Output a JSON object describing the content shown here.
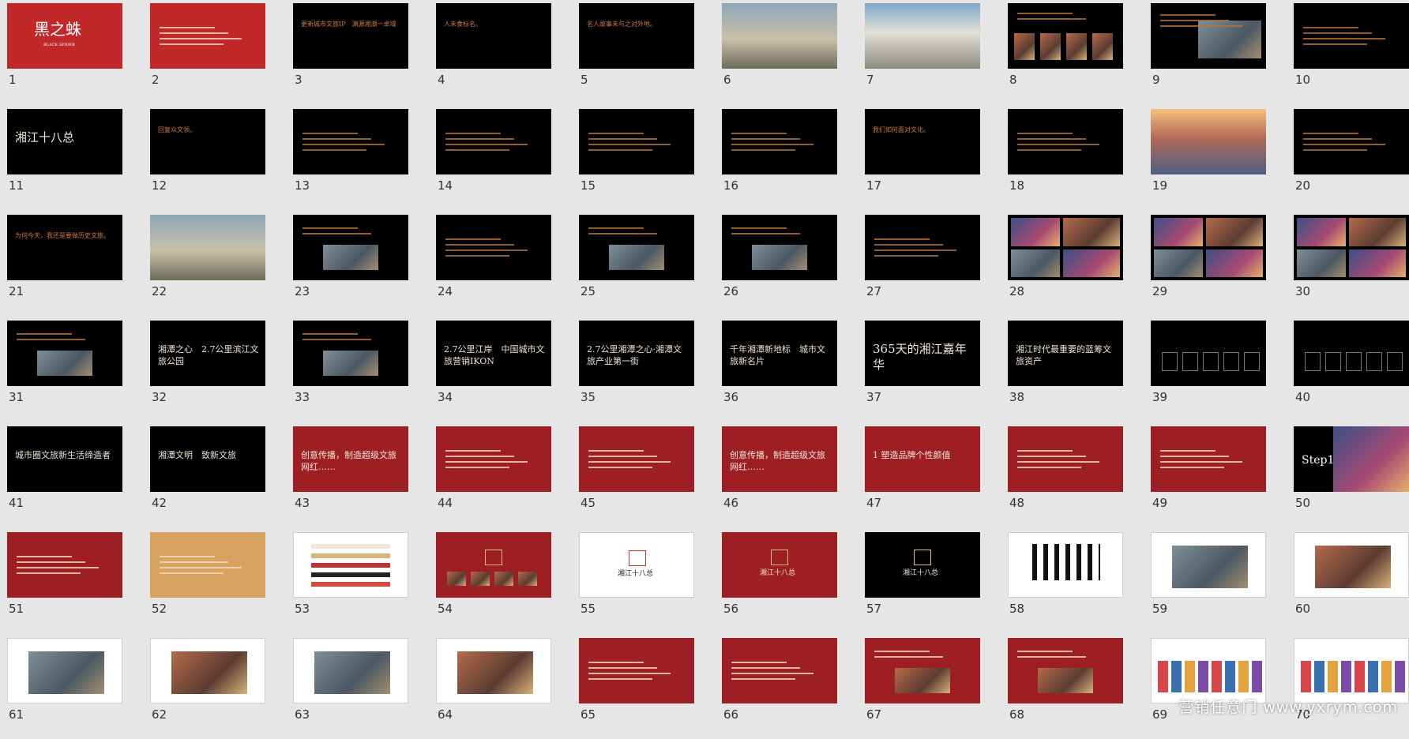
{
  "watermark": "营销任意门 www.yxrym.com",
  "slides": [
    {
      "n": "1",
      "bg": "red",
      "title": "黑之蛛",
      "sub": "BLACK SPIDER",
      "style": "big"
    },
    {
      "n": "2",
      "bg": "red",
      "title": "",
      "style": "lines"
    },
    {
      "n": "3",
      "bg": "black",
      "title": "更新城市文旅IP　渊源湘潮一卓域",
      "style": "main"
    },
    {
      "n": "4",
      "bg": "black",
      "title": "人未食标名。",
      "style": "main"
    },
    {
      "n": "5",
      "bg": "black",
      "title": "名人故事未与之对外地。",
      "style": "main"
    },
    {
      "n": "6",
      "bg": "photo",
      "title": "",
      "style": "photo"
    },
    {
      "n": "7",
      "bg": "photo2",
      "title": "",
      "style": "photo"
    },
    {
      "n": "8",
      "bg": "black",
      "title": "",
      "style": "portraits"
    },
    {
      "n": "9",
      "bg": "black",
      "title": "",
      "style": "map"
    },
    {
      "n": "10",
      "bg": "black",
      "title": "",
      "style": "lines"
    },
    {
      "n": "11",
      "bg": "black",
      "title": "湘江十八总",
      "style": "big"
    },
    {
      "n": "12",
      "bg": "black",
      "title": "回复众文领。",
      "style": "main"
    },
    {
      "n": "13",
      "bg": "black",
      "title": "",
      "style": "lines"
    },
    {
      "n": "14",
      "bg": "black",
      "title": "",
      "style": "lines"
    },
    {
      "n": "15",
      "bg": "black",
      "title": "",
      "style": "lines"
    },
    {
      "n": "16",
      "bg": "black",
      "title": "",
      "style": "lines"
    },
    {
      "n": "17",
      "bg": "black",
      "title": "我们如何面对文化。",
      "style": "main"
    },
    {
      "n": "18",
      "bg": "black",
      "title": "",
      "style": "lines"
    },
    {
      "n": "19",
      "bg": "city",
      "title": "",
      "style": "photo"
    },
    {
      "n": "20",
      "bg": "black",
      "title": "",
      "style": "lines"
    },
    {
      "n": "21",
      "bg": "black",
      "title": "为何今天，我还是要做历史文旅。",
      "style": "main"
    },
    {
      "n": "22",
      "bg": "photo",
      "title": "",
      "style": "photo"
    },
    {
      "n": "23",
      "bg": "black",
      "title": "",
      "style": "img"
    },
    {
      "n": "24",
      "bg": "black",
      "title": "",
      "style": "lines"
    },
    {
      "n": "25",
      "bg": "black",
      "title": "",
      "style": "img"
    },
    {
      "n": "26",
      "bg": "black",
      "title": "",
      "style": "img"
    },
    {
      "n": "27",
      "bg": "black",
      "title": "",
      "style": "lines"
    },
    {
      "n": "28",
      "bg": "black",
      "title": "",
      "style": "collage"
    },
    {
      "n": "29",
      "bg": "black",
      "title": "",
      "style": "collage"
    },
    {
      "n": "30",
      "bg": "black",
      "title": "",
      "style": "collage"
    },
    {
      "n": "31",
      "bg": "black",
      "title": "",
      "style": "img"
    },
    {
      "n": "32",
      "bg": "black",
      "title": "湘潭之心　2.7公里滨江文旅公园",
      "style": "mid"
    },
    {
      "n": "33",
      "bg": "black",
      "title": "",
      "style": "img"
    },
    {
      "n": "34",
      "bg": "black",
      "title": "2.7公里江岸　中国城市文旅营销IKON",
      "style": "mid"
    },
    {
      "n": "35",
      "bg": "black",
      "title": "2.7公里湘潭之心·湘潭文旅产业第一街",
      "style": "mid"
    },
    {
      "n": "36",
      "bg": "black",
      "title": "千年湘潭新地标　城市文旅新名片",
      "style": "mid"
    },
    {
      "n": "37",
      "bg": "black",
      "title": "365天的湘江嘉年华",
      "style": "big"
    },
    {
      "n": "38",
      "bg": "black",
      "title": "湘江时代最重要的蓝筹文旅资产",
      "style": "mid"
    },
    {
      "n": "39",
      "bg": "black",
      "title": "",
      "style": "tree"
    },
    {
      "n": "40",
      "bg": "black",
      "title": "",
      "style": "tree"
    },
    {
      "n": "41",
      "bg": "black",
      "title": "城市圈文旅新生活缔造者",
      "style": "mid"
    },
    {
      "n": "42",
      "bg": "black",
      "title": "湘潭文明　致新文旅",
      "style": "mid"
    },
    {
      "n": "43",
      "bg": "dred",
      "title": "创意传播，制造超级文旅网红……",
      "style": "mid"
    },
    {
      "n": "44",
      "bg": "dred",
      "title": "",
      "style": "lines"
    },
    {
      "n": "45",
      "bg": "dred",
      "title": "",
      "style": "lines"
    },
    {
      "n": "46",
      "bg": "dred",
      "title": "创意传播，制造超级文旅网红……",
      "style": "mid"
    },
    {
      "n": "47",
      "bg": "dred",
      "title": "1 塑造品牌个性颜值",
      "style": "mid"
    },
    {
      "n": "48",
      "bg": "dred",
      "title": "",
      "style": "lines"
    },
    {
      "n": "49",
      "bg": "dred",
      "title": "",
      "style": "lines"
    },
    {
      "n": "50",
      "bg": "black",
      "title": "Step1",
      "style": "step"
    },
    {
      "n": "51",
      "bg": "dred",
      "title": "",
      "style": "lines"
    },
    {
      "n": "52",
      "bg": "tan",
      "title": "",
      "style": "lines"
    },
    {
      "n": "53",
      "bg": "white",
      "title": "",
      "style": "bars"
    },
    {
      "n": "54",
      "bg": "dred",
      "title": "",
      "style": "logo"
    },
    {
      "n": "55",
      "bg": "white",
      "title": "湘江十八总",
      "style": "logo"
    },
    {
      "n": "56",
      "bg": "dred",
      "title": "湘江十八总",
      "style": "logo"
    },
    {
      "n": "57",
      "bg": "black",
      "title": "湘江十八总",
      "style": "logo"
    },
    {
      "n": "58",
      "bg": "white",
      "title": "",
      "style": "calli"
    },
    {
      "n": "59",
      "bg": "white",
      "title": "",
      "style": "prod"
    },
    {
      "n": "60",
      "bg": "white",
      "title": "",
      "style": "prod"
    },
    {
      "n": "61",
      "bg": "white",
      "title": "",
      "style": "prod"
    },
    {
      "n": "62",
      "bg": "white",
      "title": "",
      "style": "prod"
    },
    {
      "n": "63",
      "bg": "white",
      "title": "",
      "style": "prod"
    },
    {
      "n": "64",
      "bg": "white",
      "title": "",
      "style": "prod"
    },
    {
      "n": "65",
      "bg": "dred",
      "title": "",
      "style": "lines"
    },
    {
      "n": "66",
      "bg": "dred",
      "title": "",
      "style": "lines"
    },
    {
      "n": "67",
      "bg": "dred",
      "title": "",
      "style": "img"
    },
    {
      "n": "68",
      "bg": "dred",
      "title": "",
      "style": "img"
    },
    {
      "n": "69",
      "bg": "white",
      "title": "",
      "style": "chars"
    },
    {
      "n": "70",
      "bg": "white",
      "title": "",
      "style": "chars"
    }
  ]
}
